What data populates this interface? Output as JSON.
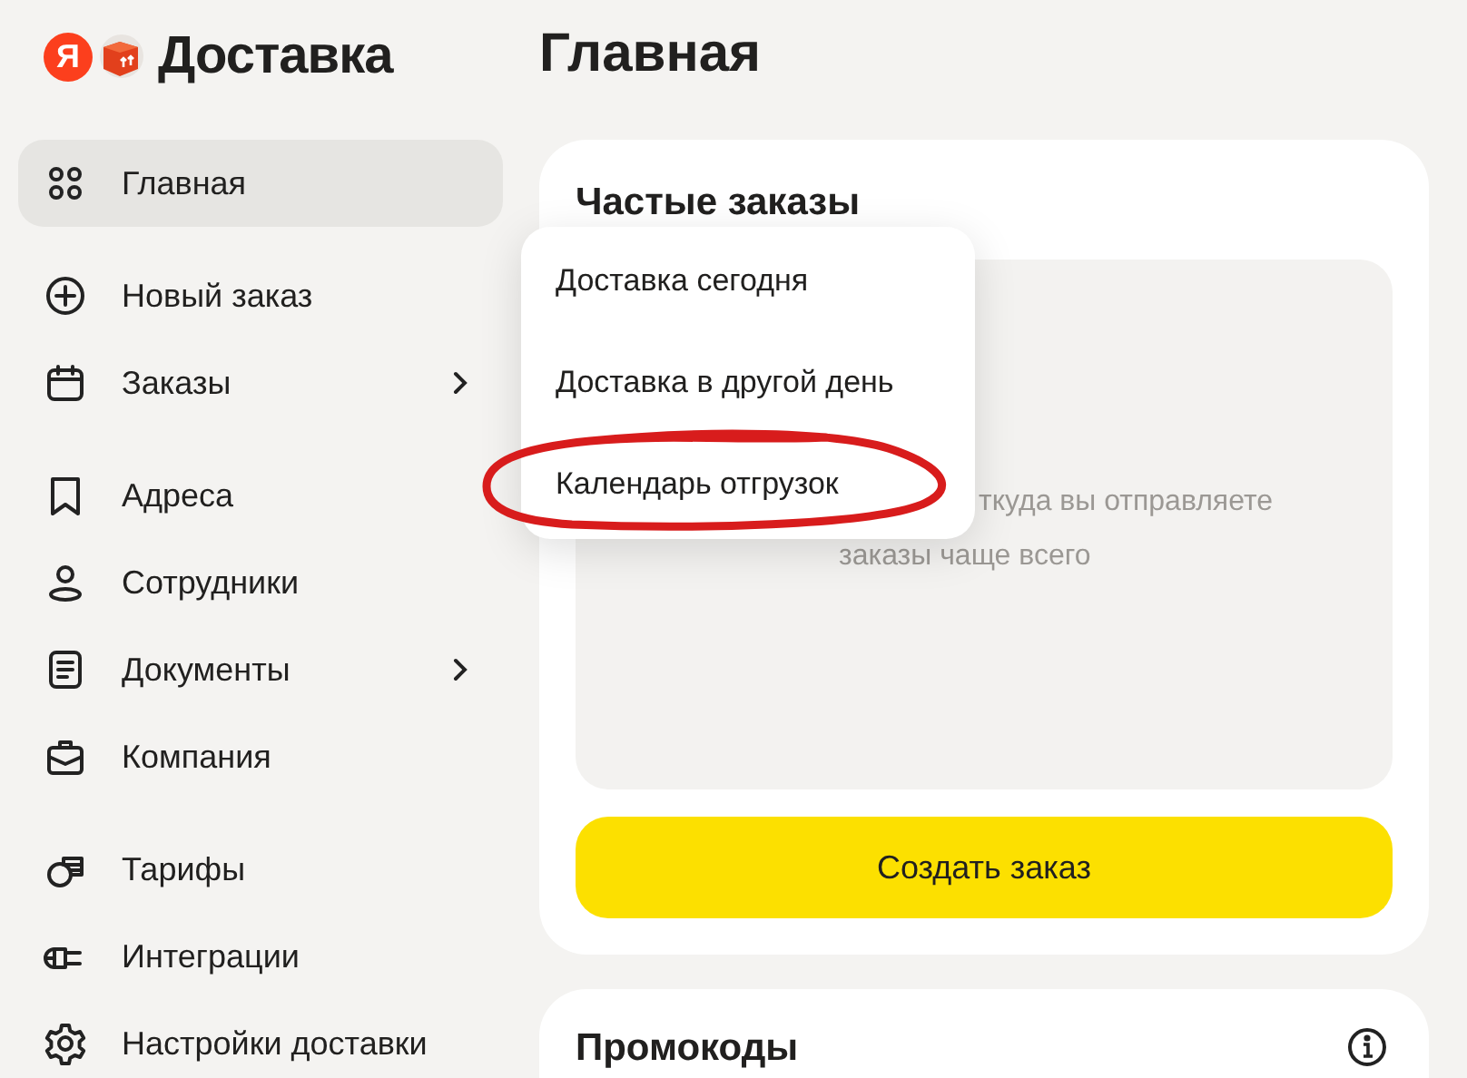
{
  "logo": {
    "mark": "Я",
    "text": "Доставка"
  },
  "sidebar": {
    "groups": [
      {
        "items": [
          {
            "label": "Главная",
            "selected": true,
            "expandable": false
          }
        ]
      },
      {
        "items": [
          {
            "label": "Новый заказ",
            "selected": false,
            "expandable": false
          },
          {
            "label": "Заказы",
            "selected": false,
            "expandable": true
          }
        ]
      },
      {
        "items": [
          {
            "label": "Адреса",
            "selected": false,
            "expandable": false
          },
          {
            "label": "Сотрудники",
            "selected": false,
            "expandable": false
          },
          {
            "label": "Документы",
            "selected": false,
            "expandable": true
          },
          {
            "label": "Компания",
            "selected": false,
            "expandable": false
          }
        ]
      },
      {
        "items": [
          {
            "label": "Тарифы",
            "selected": false,
            "expandable": false
          },
          {
            "label": "Интеграции",
            "selected": false,
            "expandable": false
          },
          {
            "label": "Настройки доставки",
            "selected": false,
            "expandable": false
          }
        ]
      }
    ]
  },
  "page_title": "Главная",
  "frequent_orders": {
    "title": "Частые заказы",
    "hint_lines": [
      "ткуда вы отправляете",
      "заказы чаще всего"
    ],
    "button": "Создать заказ"
  },
  "promo": {
    "title": "Промокоды"
  },
  "dropdown": {
    "items": [
      {
        "label": "Доставка сегодня",
        "circled": false
      },
      {
        "label": "Доставка в другой день",
        "circled": false
      },
      {
        "label": "Календарь отгрузок",
        "circled": true
      }
    ]
  }
}
